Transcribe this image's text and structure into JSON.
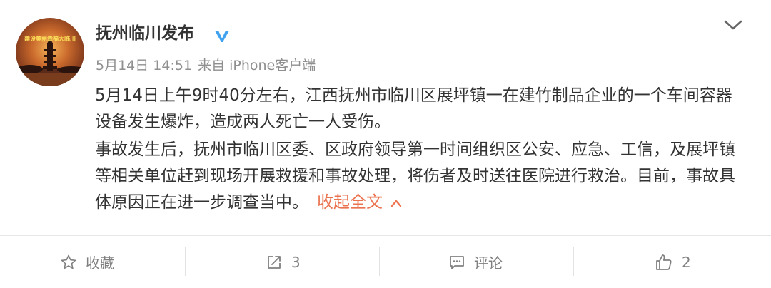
{
  "post": {
    "author": "抚州临川发布",
    "avatar_text": "建设美丽幸福大临川",
    "date": "5月14日 14:51",
    "source": "来自 iPhone客户端",
    "paragraph1": "5月14日上午9时40分左右，江西抚州市临川区展坪镇一在建竹制品企业的一个车间容器设备发生爆炸，造成两人死亡一人受伤。",
    "paragraph2": "事故发生后，抚州市临川区委、区政府领导第一时间组织区公安、应急、工信，及展坪镇等相关单位赶到现场开展救援和事故处理，将伤者及时送往医院进行救治。目前，事故具体原因正在进一步调查当中。",
    "collapse_label": "收起全文"
  },
  "actions": {
    "favorite_label": "收藏",
    "repost_count": "3",
    "comment_label": "评论",
    "like_count": "2"
  },
  "icons": {
    "verified": "verified-v-icon",
    "expand": "chevron-down-icon",
    "collapse": "chevron-up-icon",
    "favorite": "star-icon",
    "repost": "share-arrow-icon",
    "comment": "comment-bubble-icon",
    "like": "thumbs-up-icon"
  },
  "colors": {
    "accent": "#eb7350",
    "verified": "#41a2ef",
    "meta_text": "#8f8f8f"
  }
}
